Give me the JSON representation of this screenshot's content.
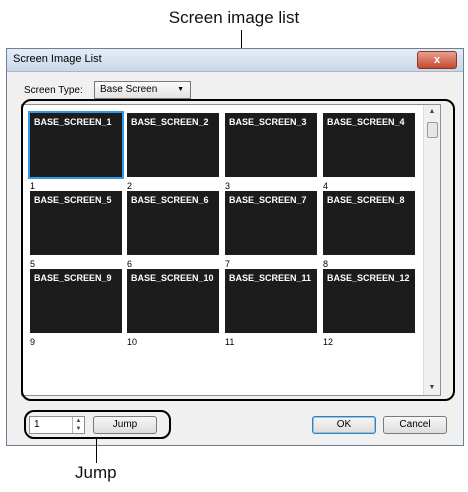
{
  "callouts": {
    "top": "Screen image list",
    "bottom": "Jump"
  },
  "window": {
    "title": "Screen Image List",
    "close_glyph": "x"
  },
  "screen_type": {
    "label": "Screen Type:",
    "value": "Base Screen"
  },
  "screens": [
    {
      "name": "BASE_SCREEN_1",
      "number": "1",
      "selected": true
    },
    {
      "name": "BASE_SCREEN_2",
      "number": "2"
    },
    {
      "name": "BASE_SCREEN_3",
      "number": "3"
    },
    {
      "name": "BASE_SCREEN_4",
      "number": "4"
    },
    {
      "name": "BASE_SCREEN_5",
      "number": "5"
    },
    {
      "name": "BASE_SCREEN_6",
      "number": "6"
    },
    {
      "name": "BASE_SCREEN_7",
      "number": "7"
    },
    {
      "name": "BASE_SCREEN_8",
      "number": "8"
    },
    {
      "name": "BASE_SCREEN_9",
      "number": "9"
    },
    {
      "name": "BASE_SCREEN_10",
      "number": "10"
    },
    {
      "name": "BASE_SCREEN_11",
      "number": "11"
    },
    {
      "name": "BASE_SCREEN_12",
      "number": "12"
    }
  ],
  "jump": {
    "value": "1",
    "button_label": "Jump"
  },
  "buttons": {
    "ok": "OK",
    "cancel": "Cancel"
  }
}
